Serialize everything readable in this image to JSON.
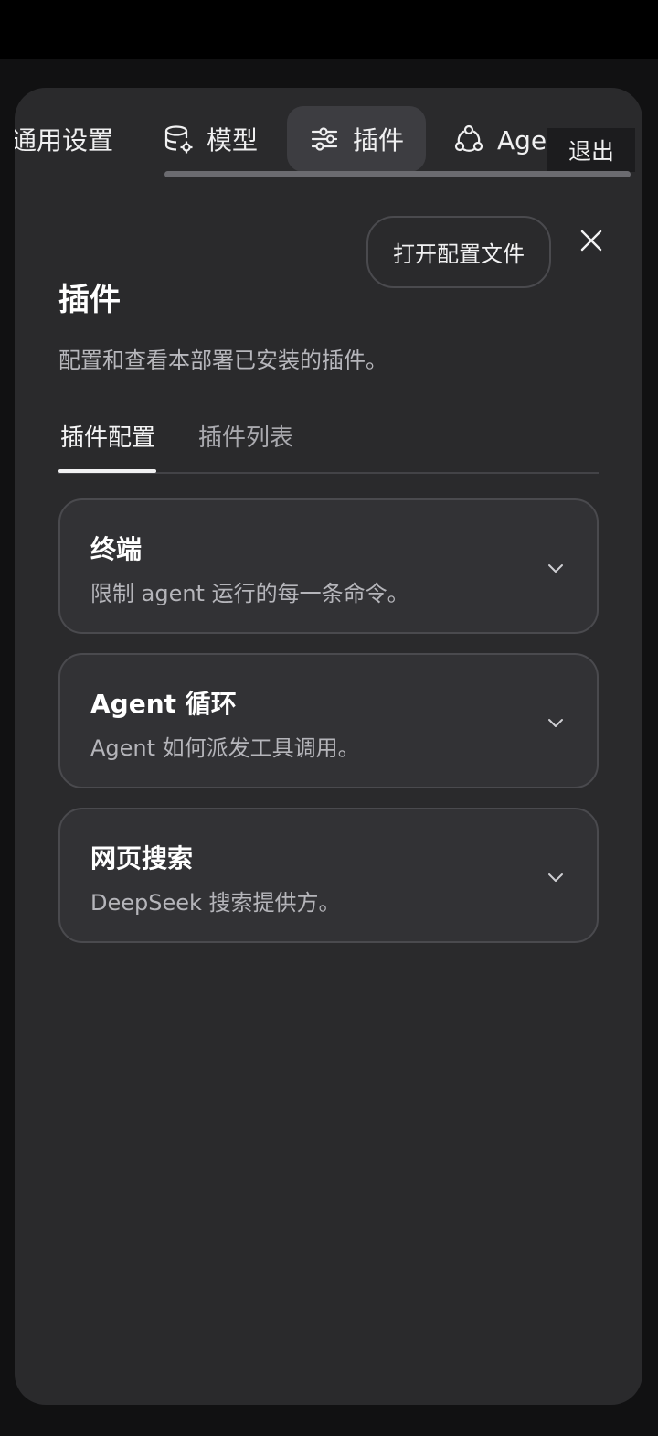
{
  "nav": {
    "items": [
      {
        "label": "通用设置",
        "icon": "settings"
      },
      {
        "label": "模型",
        "icon": "database-gear-icon"
      },
      {
        "label": "插件",
        "icon": "sliders-icon",
        "active": true
      },
      {
        "label": "Agent 预设",
        "icon": "agent-nodes-icon"
      }
    ],
    "logout_label": "退出"
  },
  "header": {
    "open_config_label": "打开配置文件",
    "close_icon": "close-icon",
    "title": "插件",
    "subtitle": "配置和查看本部署已安装的插件。"
  },
  "tabs": [
    {
      "label": "插件配置",
      "active": true
    },
    {
      "label": "插件列表",
      "active": false
    }
  ],
  "cards": [
    {
      "title": "终端",
      "description": "限制 agent 运行的每一条命令。"
    },
    {
      "title": "Agent 循环",
      "description": "Agent 如何派发工具调用。"
    },
    {
      "title": "网页搜索",
      "description": "DeepSeek 搜索提供方。"
    }
  ],
  "colors": {
    "panel_bg": "#2a2a2c",
    "card_bg": "#323235",
    "active_nav_bg": "#3d3d41",
    "text_primary": "#ffffff",
    "text_secondary": "#b5b5ba"
  }
}
